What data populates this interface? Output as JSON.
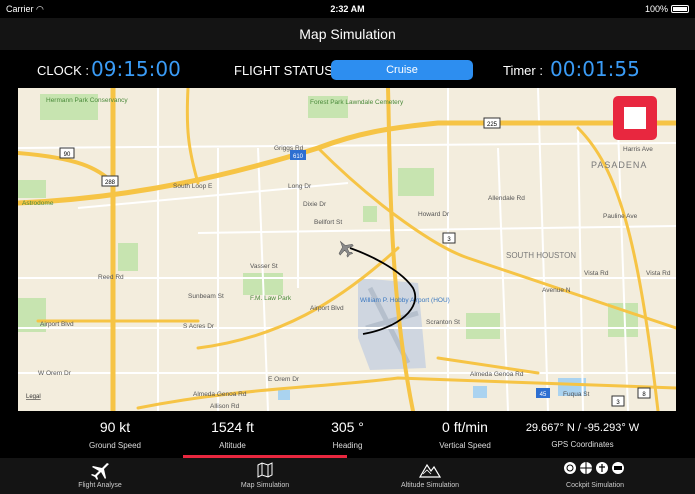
{
  "status_bar": {
    "carrier": "Carrier",
    "time": "2:32 AM",
    "battery": "100%"
  },
  "nav": {
    "title": "Map Simulation"
  },
  "info": {
    "clock_label": "CLOCK :",
    "clock_value": "09:15:00",
    "status_label": "FLIGHT STATUS :",
    "status_value": "Cruise",
    "timer_label": "Timer :",
    "timer_value": "00:01:55"
  },
  "map": {
    "labels": {
      "hermann_park": "Hermann Park Conservancy",
      "forest_park": "Forest Park Lawndale Cemetery",
      "pasadena": "PASADENA",
      "harris_ave": "Harris Ave",
      "pauline_ave": "Pauline Ave",
      "astrodome": "Astrodome",
      "south_loop": "South Loop E",
      "griggs": "Griggs Rd",
      "long_dr": "Long Dr",
      "dixie": "Dixie Dr",
      "bellfort": "Bellfort St",
      "allendale": "Allendale Rd",
      "howard": "Howard Dr",
      "south_houston": "SOUTH HOUSTON",
      "vista_rd": "Vista Rd",
      "vista_rd2": "Vista Rd",
      "avenue_n": "Avenue N",
      "reed": "Reed Rd",
      "vasser": "Vasser St",
      "sunbeam": "Sunbeam St",
      "fm_law_park": "F.M. Law Park",
      "airport_blvd": "Airport Blvd",
      "airport_blvd2": "Airport Blvd",
      "hobby": "William P. Hobby Airport (HOU)",
      "scranton": "Scranton St",
      "s_acres": "S Acres Dr",
      "e_orem": "E Orem Dr",
      "w_orem": "W Orem Dr",
      "almeda_genoa": "Almeda Genoa Rd",
      "almeda_genoa2": "Almeda Genoa Rd",
      "allison": "Allison Rd",
      "fuqua": "Fuqua St",
      "legal": "Legal",
      "hwy_90": "90",
      "hwy_288": "288",
      "hwy_610": "610",
      "hwy_225": "225",
      "hwy_3": "3",
      "hwy_3b": "3",
      "hwy_45": "45",
      "hwy_8": "8"
    }
  },
  "stats": {
    "ground_speed": {
      "value": "90 kt",
      "label": "Ground Speed"
    },
    "altitude": {
      "value": "1524 ft",
      "label": "Altitude"
    },
    "heading": {
      "value": "305 °",
      "label": "Heading"
    },
    "vertical_speed": {
      "value": "0 ft/min",
      "label": "Vertical Speed"
    },
    "gps": {
      "value": "29.667° N  /  -95.293° W",
      "label": "GPS Coordinates"
    }
  },
  "tabs": [
    {
      "label": "Flight Analyse",
      "icon": "airplane-icon"
    },
    {
      "label": "Map Simulation",
      "icon": "map-icon"
    },
    {
      "label": "Altitude Simulation",
      "icon": "mountain-icon"
    },
    {
      "label": "Cockpit Simulation",
      "icon": "cockpit-gauges-icon"
    }
  ],
  "colors": {
    "accent": "#2d8ef0",
    "stop": "#e8273f",
    "route": "#000000"
  }
}
